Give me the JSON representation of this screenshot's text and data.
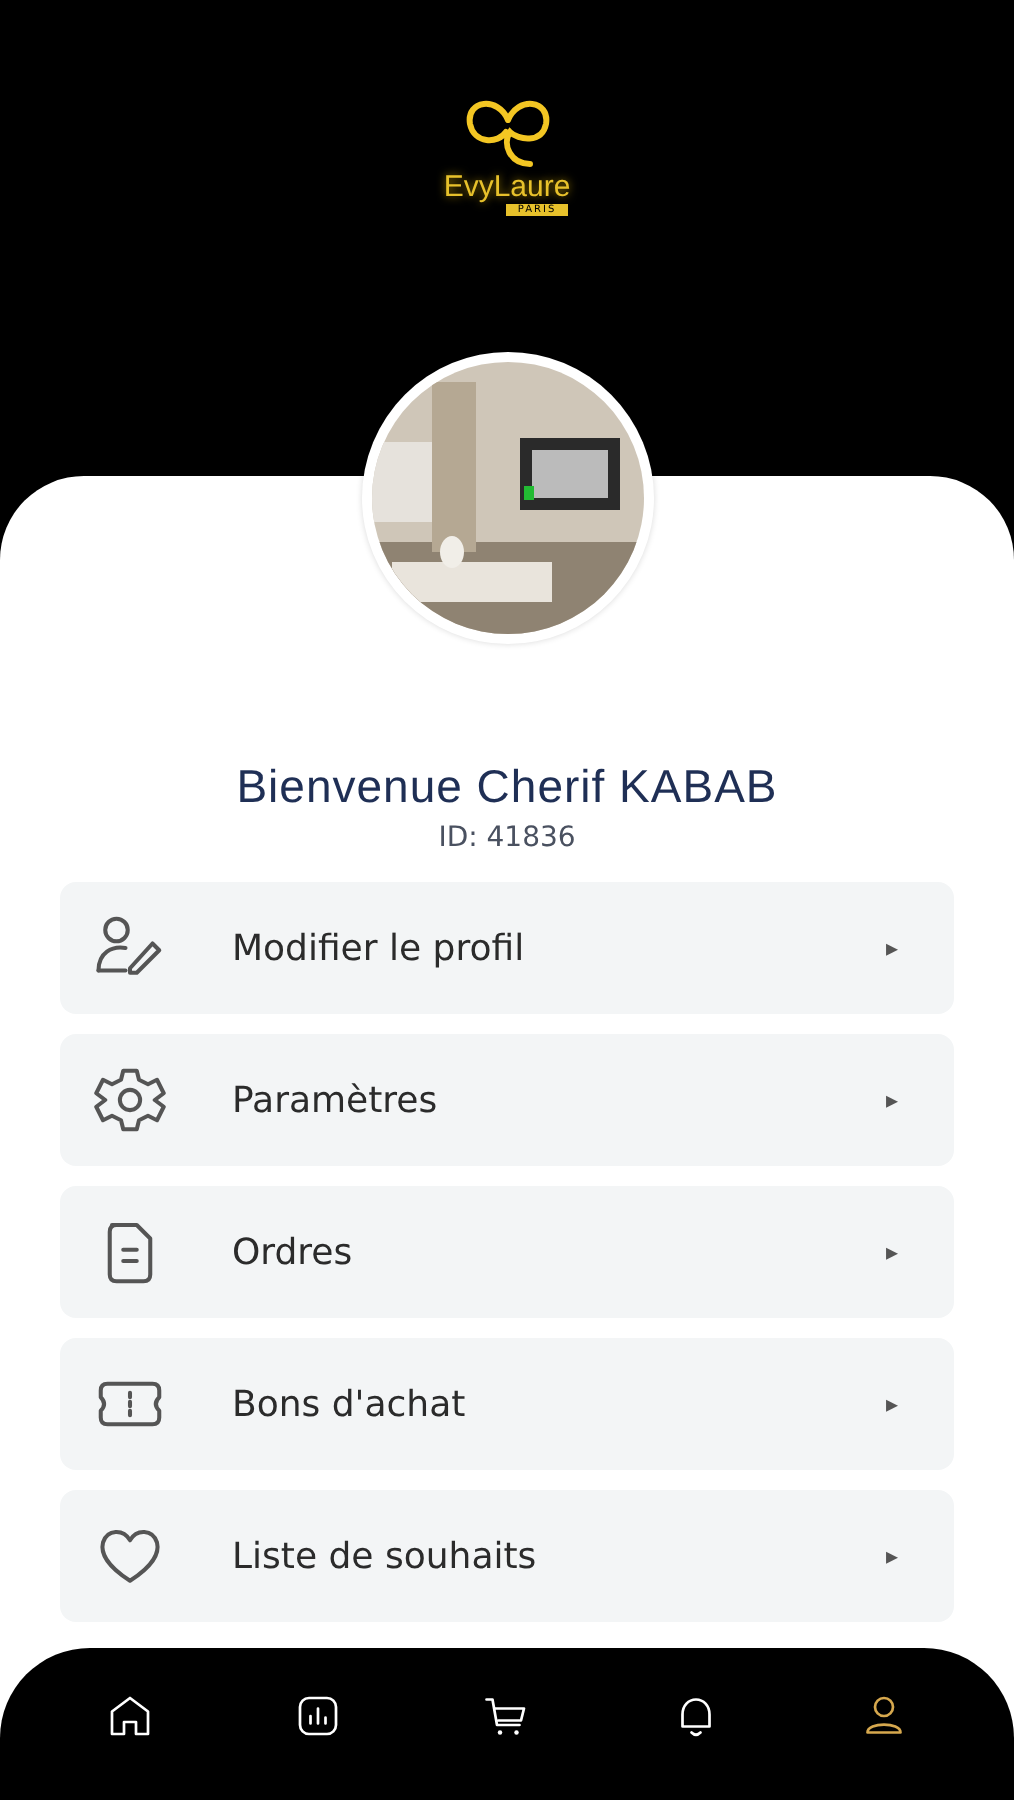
{
  "logo": {
    "name": "EvyLaure",
    "tagline": "PARIS"
  },
  "profile": {
    "greeting": "Bienvenue Cherif KABAB",
    "id_label": "ID: 41836"
  },
  "menu": [
    {
      "label": "Modifier le profil",
      "chevron": "▸"
    },
    {
      "label": "Paramètres",
      "chevron": "▸"
    },
    {
      "label": "Ordres",
      "chevron": "▸"
    },
    {
      "label": "Bons d'achat",
      "chevron": "▸"
    },
    {
      "label": "Liste de souhaits",
      "chevron": "▸"
    }
  ],
  "nav": [
    {
      "selected": false
    },
    {
      "selected": false
    },
    {
      "selected": false
    },
    {
      "selected": false
    },
    {
      "selected": true
    }
  ]
}
